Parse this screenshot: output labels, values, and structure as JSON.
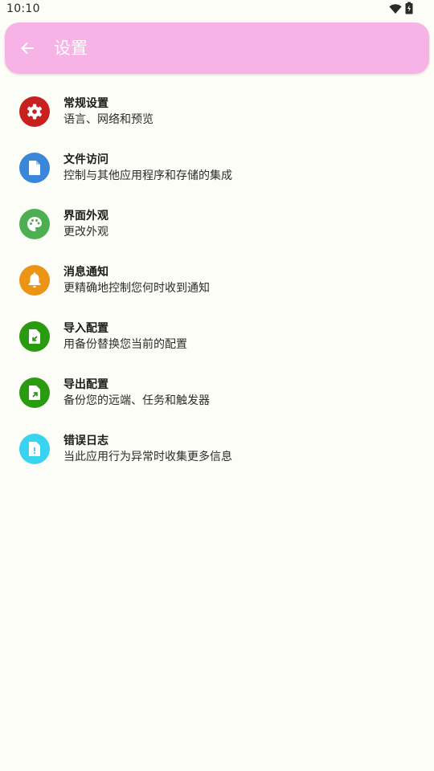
{
  "status_bar": {
    "time": "10:10",
    "wifi_icon": "wifi-icon",
    "battery_icon": "battery-icon"
  },
  "app_bar": {
    "back_icon": "arrow-back-icon",
    "title": "设置",
    "color": "#f7b2e6"
  },
  "settings": {
    "items": [
      {
        "title": "常规设置",
        "subtitle": "语言、网络和预览",
        "icon": "gear-icon",
        "color": "#c8201e"
      },
      {
        "title": "文件访问",
        "subtitle": "控制与其他应用程序和存储的集成",
        "icon": "file-icon",
        "color": "#3a87d9"
      },
      {
        "title": "界面外观",
        "subtitle": "更改外观",
        "icon": "palette-icon",
        "color": "#4caf50"
      },
      {
        "title": "消息通知",
        "subtitle": "更精确地控制您何时收到通知",
        "icon": "bell-icon",
        "color": "#ec9414"
      },
      {
        "title": "导入配置",
        "subtitle": "用备份替换您当前的配置",
        "icon": "file-import-icon",
        "color": "#2a9a10"
      },
      {
        "title": "导出配置",
        "subtitle": "备份您的远端、任务和触发器",
        "icon": "file-export-icon",
        "color": "#2a9a10"
      },
      {
        "title": "错误日志",
        "subtitle": "当此应用行为异常时收集更多信息",
        "icon": "file-error-icon",
        "color": "#38d3ee"
      }
    ]
  }
}
